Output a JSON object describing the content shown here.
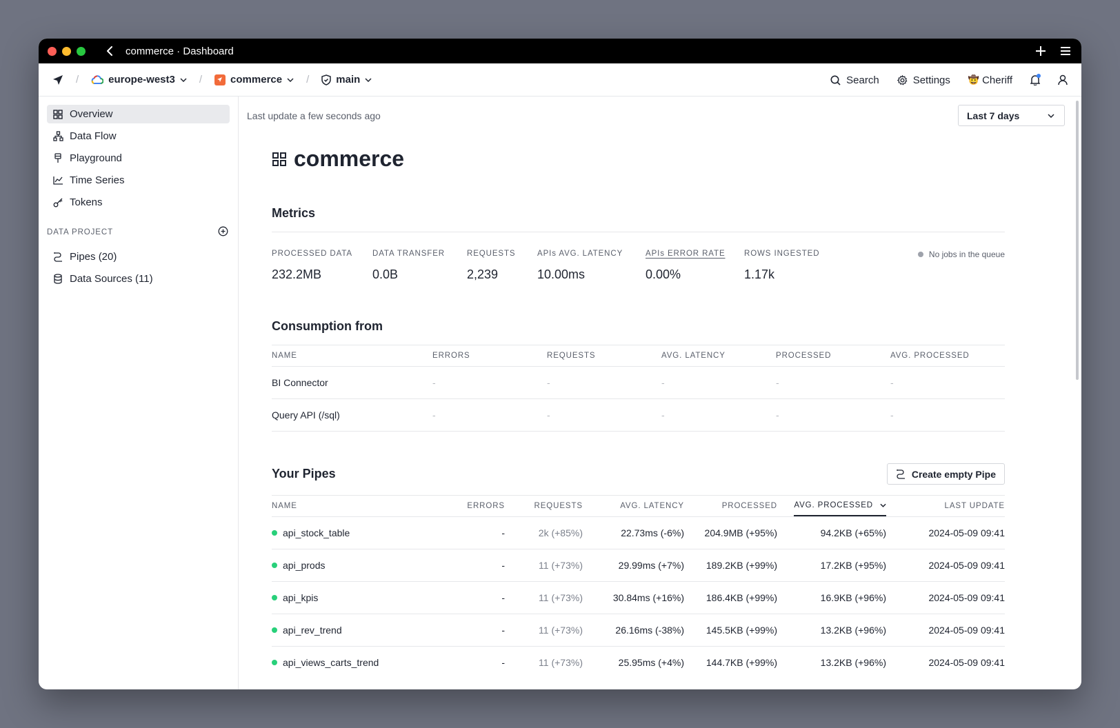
{
  "window": {
    "title": "commerce · Dashboard"
  },
  "nav": {
    "region": "europe-west3",
    "workspace": "commerce",
    "branch": "main",
    "search_label": "Search",
    "settings_label": "Settings",
    "user_label": "Cheriff"
  },
  "sidebar": {
    "items": [
      {
        "label": "Overview",
        "icon": "grid-icon"
      },
      {
        "label": "Data Flow",
        "icon": "flow-icon"
      },
      {
        "label": "Playground",
        "icon": "playground-icon"
      },
      {
        "label": "Time Series",
        "icon": "chart-icon"
      },
      {
        "label": "Tokens",
        "icon": "key-icon"
      }
    ],
    "section_label": "DATA PROJECT",
    "project_items": [
      {
        "label": "Pipes (20)",
        "icon": "pipe-icon"
      },
      {
        "label": "Data Sources (11)",
        "icon": "database-icon"
      }
    ]
  },
  "main": {
    "last_update": "Last update a few seconds ago",
    "range": "Last 7 days",
    "title": "commerce",
    "metrics_title": "Metrics",
    "metrics": [
      {
        "label": "PROCESSED DATA",
        "value": "232.2MB"
      },
      {
        "label": "DATA TRANSFER",
        "value": "0.0B"
      },
      {
        "label": "REQUESTS",
        "value": "2,239"
      },
      {
        "label": "APIs AVG. LATENCY",
        "value": "10.00ms"
      },
      {
        "label": "APIs ERROR RATE",
        "value": "0.00%"
      },
      {
        "label": "ROWS INGESTED",
        "value": "1.17k"
      }
    ],
    "queue_status": "No jobs in the queue",
    "consumption_title": "Consumption from",
    "consumption_headers": [
      "NAME",
      "ERRORS",
      "REQUESTS",
      "AVG. LATENCY",
      "PROCESSED",
      "AVG. PROCESSED"
    ],
    "consumption_rows": [
      [
        "BI Connector",
        "-",
        "-",
        "-",
        "-",
        "-"
      ],
      [
        "Query API (/sql)",
        "-",
        "-",
        "-",
        "-",
        "-"
      ]
    ],
    "pipes_title": "Your Pipes",
    "create_pipe_label": "Create empty Pipe",
    "pipes_headers": [
      "NAME",
      "ERRORS",
      "REQUESTS",
      "AVG. LATENCY",
      "PROCESSED",
      "AVG. PROCESSED",
      "LAST UPDATE"
    ],
    "pipes_rows": [
      [
        "api_stock_table",
        "-",
        "2k (+85%)",
        "22.73ms (-6%)",
        "204.9MB (+95%)",
        "94.2KB (+65%)",
        "2024-05-09 09:41"
      ],
      [
        "api_prods",
        "-",
        "11 (+73%)",
        "29.99ms (+7%)",
        "189.2KB (+99%)",
        "17.2KB (+95%)",
        "2024-05-09 09:41"
      ],
      [
        "api_kpis",
        "-",
        "11 (+73%)",
        "30.84ms (+16%)",
        "186.4KB (+99%)",
        "16.9KB (+96%)",
        "2024-05-09 09:41"
      ],
      [
        "api_rev_trend",
        "-",
        "11 (+73%)",
        "26.16ms (-38%)",
        "145.5KB (+99%)",
        "13.2KB (+96%)",
        "2024-05-09 09:41"
      ],
      [
        "api_views_carts_trend",
        "-",
        "11 (+73%)",
        "25.95ms (+4%)",
        "144.7KB (+99%)",
        "13.2KB (+96%)",
        "2024-05-09 09:41"
      ]
    ]
  }
}
